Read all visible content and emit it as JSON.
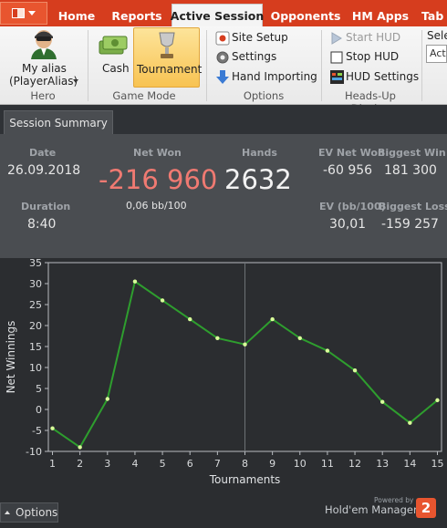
{
  "tabs": [
    {
      "label": "Home"
    },
    {
      "label": "Reports"
    },
    {
      "label": "Active Session"
    },
    {
      "label": "Opponents"
    },
    {
      "label": "HM Apps"
    },
    {
      "label": "Tab"
    }
  ],
  "ribbon": {
    "hero_alias_line1": "My alias",
    "hero_alias_line2": "(PlayerAlias)",
    "hero_group": "Hero",
    "cash_label": "Cash",
    "tournament_label": "Tournament",
    "game_mode_group": "Game Mode",
    "site_setup": "Site Setup",
    "settings": "Settings",
    "hand_importing": "Hand Importing",
    "options_group": "Options",
    "start_hud": "Start HUD",
    "stop_hud": "Stop HUD",
    "hud_settings": "HUD Settings",
    "hud_group": "Heads-Up Display",
    "select_label": "Sele",
    "select_value": "Activ"
  },
  "session_tab": "Session Summary",
  "summary": {
    "date_label": "Date",
    "date_value": "26.09.2018",
    "duration_label": "Duration",
    "duration_value": "8:40",
    "net_won_label": "Net Won",
    "net_won_value": "-216 960",
    "bb_per_100": "0,06 bb/100",
    "hands_label": "Hands",
    "hands_value": "2632",
    "ev_net_won_label": "EV Net Won",
    "ev_net_won_value": "-60 956",
    "biggest_win_label": "Biggest Win",
    "biggest_win_value": "181 300",
    "ev_bb_label": "EV (bb/100)",
    "ev_bb_value": "30,01",
    "biggest_loss_label": "Biggest Loss",
    "biggest_loss_value": "-159 257"
  },
  "colors": {
    "accent": "#d63d1e",
    "net_won": "#f07a72",
    "line": "#2e9e2e",
    "marker": "#d9ff9a"
  },
  "chart_data": {
    "type": "line",
    "xlabel": "Tournaments",
    "ylabel": "Net Winnings",
    "x": [
      1,
      2,
      3,
      4,
      5,
      6,
      7,
      8,
      9,
      10,
      11,
      12,
      13,
      14,
      15
    ],
    "series": [
      {
        "values": [
          -4.5,
          -9,
          2.5,
          30.5,
          26,
          21.5,
          17,
          15.5,
          21.5,
          17,
          14,
          9.3,
          1.8,
          -3.2,
          2.2
        ]
      }
    ],
    "xlim": [
      0.85,
      15.15
    ],
    "ylim": [
      -10,
      35
    ],
    "yticks": [
      35,
      30,
      25,
      20,
      15,
      10,
      5,
      0,
      -5,
      -10
    ],
    "grid": false
  },
  "footer": {
    "options_label": "Options",
    "powered_by": "Powered by",
    "brand": "Hold'em Manager",
    "badge": "2"
  }
}
